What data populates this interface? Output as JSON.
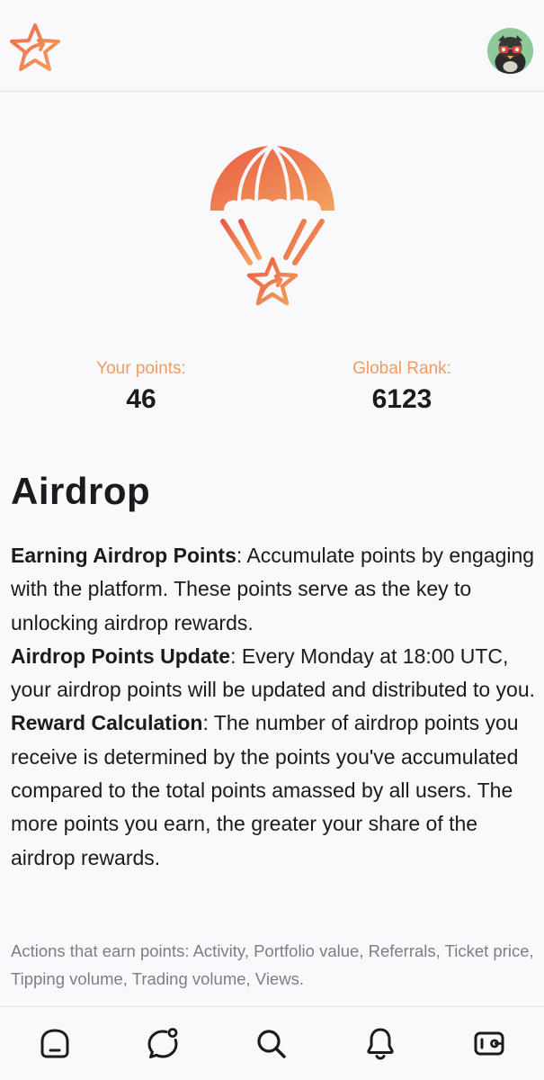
{
  "header": {
    "logo_icon": "star-arrow-logo-icon",
    "avatar_icon": "user-avatar"
  },
  "hero": {
    "icon": "parachute-star-icon",
    "colors": {
      "accent": "#ec6e4c",
      "accent_light": "#f09e62"
    }
  },
  "stats": {
    "points_label": "Your points:",
    "points_value": "46",
    "rank_label": "Global Rank:",
    "rank_value": "6123"
  },
  "airdrop": {
    "title": "Airdrop",
    "sections": [
      {
        "heading": "Earning Airdrop Points",
        "text": ": Accumulate points by engaging with the platform. These points serve as the key to unlocking airdrop rewards."
      },
      {
        "heading": "Airdrop Points Update",
        "text": ": Every Monday at 18:00 UTC, your airdrop points will be updated and distributed to you."
      },
      {
        "heading": "Reward Calculation",
        "text": ": The number of airdrop points you receive is determined by the points you've accumulated compared to the total points amassed by all users. The more points you earn, the greater your share of the airdrop rewards."
      }
    ],
    "footnote": "Actions that earn points: Activity, Portfolio value, Referrals, Ticket price, Tipping volume, Trading volume, Views."
  },
  "nav": {
    "items": [
      {
        "icon": "home-icon"
      },
      {
        "icon": "chat-icon"
      },
      {
        "icon": "search-icon"
      },
      {
        "icon": "bell-icon"
      },
      {
        "icon": "wallet-icon"
      }
    ]
  }
}
